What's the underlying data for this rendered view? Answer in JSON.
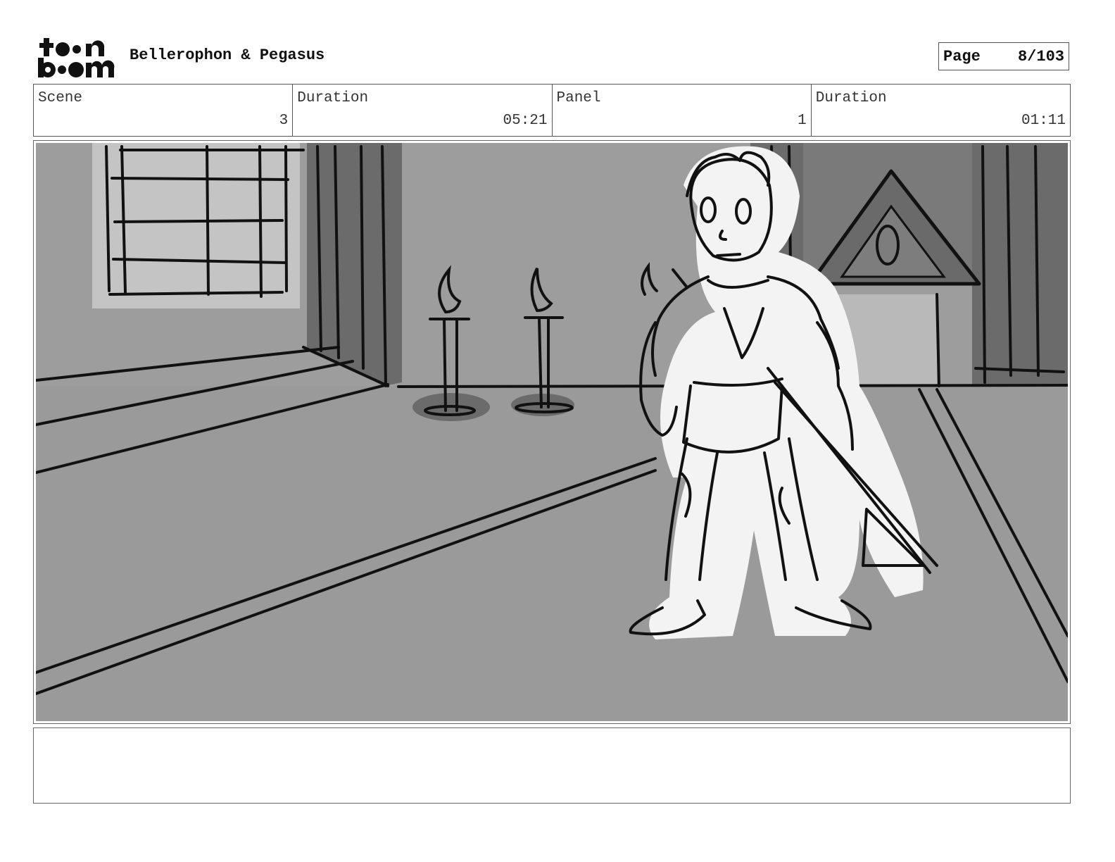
{
  "header": {
    "logo_top": "t••n",
    "logo_bottom": "b••m",
    "project_title": "Bellerophon & Pegasus",
    "page_label": "Page",
    "page_value": "8/103"
  },
  "info": {
    "scene_label": "Scene",
    "scene_value": "3",
    "scene_duration_label": "Duration",
    "scene_duration_value": "05:21",
    "panel_label": "Panel",
    "panel_value": "1",
    "panel_duration_label": "Duration",
    "panel_duration_value": "01:11"
  },
  "panel": {
    "image": "storyboard-sketch-hero-with-spear-in-temple-hall"
  },
  "notes": {
    "text": ""
  }
}
